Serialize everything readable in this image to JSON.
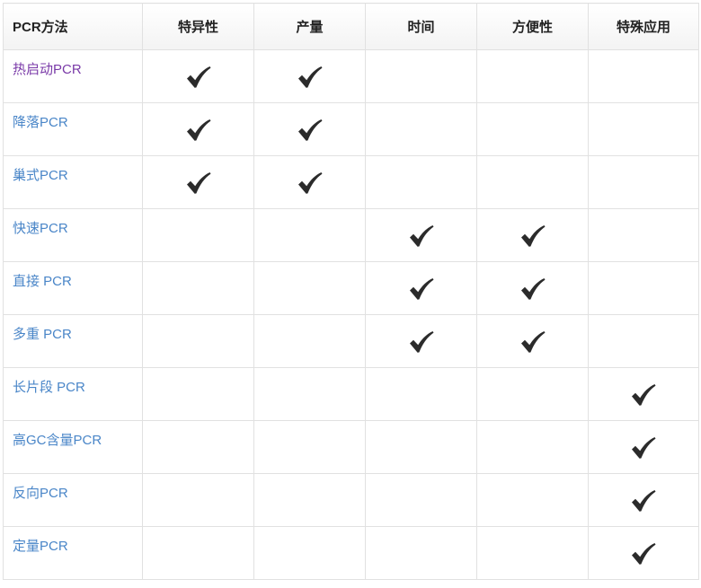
{
  "table": {
    "headers": [
      "PCR方法",
      "特异性",
      "产量",
      "时间",
      "方便性",
      "特殊应用"
    ],
    "rows": [
      {
        "name": "热启动PCR",
        "visited": true,
        "marks": [
          true,
          true,
          false,
          false,
          false
        ]
      },
      {
        "name": "降落PCR",
        "visited": false,
        "marks": [
          true,
          true,
          false,
          false,
          false
        ]
      },
      {
        "name": "巢式PCR",
        "visited": false,
        "marks": [
          true,
          true,
          false,
          false,
          false
        ]
      },
      {
        "name": "快速PCR",
        "visited": false,
        "marks": [
          false,
          false,
          true,
          true,
          false
        ]
      },
      {
        "name": "直接 PCR",
        "visited": false,
        "marks": [
          false,
          false,
          true,
          true,
          false
        ]
      },
      {
        "name": "多重 PCR",
        "visited": false,
        "marks": [
          false,
          false,
          true,
          true,
          false
        ]
      },
      {
        "name": "长片段 PCR",
        "visited": false,
        "marks": [
          false,
          false,
          false,
          false,
          true
        ]
      },
      {
        "name": "高GC含量PCR",
        "visited": false,
        "marks": [
          false,
          false,
          false,
          false,
          true
        ]
      },
      {
        "name": "反向PCR",
        "visited": false,
        "marks": [
          false,
          false,
          false,
          false,
          true
        ]
      },
      {
        "name": "定量PCR",
        "visited": false,
        "marks": [
          false,
          false,
          false,
          false,
          true
        ]
      }
    ]
  },
  "icons": {
    "check": "check-mark-icon"
  },
  "colors": {
    "link": "#4a86c8",
    "visited_link": "#7a3aa8",
    "check": "#2b2b2b",
    "border": "#e1e1e1"
  }
}
